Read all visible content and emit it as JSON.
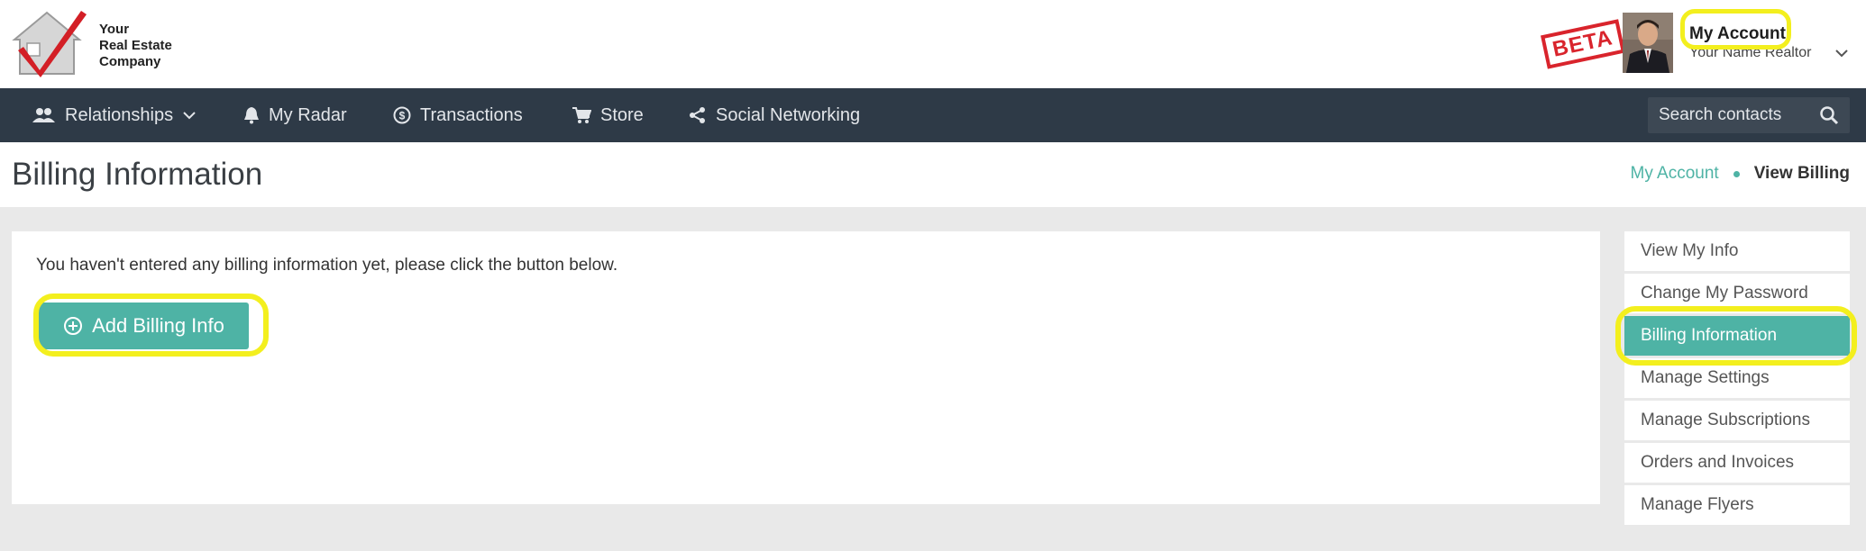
{
  "header": {
    "logo_lines": [
      "Your",
      "Real Estate",
      "Company"
    ],
    "beta_badge": "BETA",
    "account": {
      "title": "My Account",
      "name": "Your Name Realtor"
    }
  },
  "navbar": {
    "items": [
      {
        "label": "Relationships",
        "icon": "users-icon",
        "has_dropdown": true
      },
      {
        "label": "My Radar",
        "icon": "bell-icon"
      },
      {
        "label": "Transactions",
        "icon": "dollar-circle-icon"
      },
      {
        "label": "Store",
        "icon": "cart-icon"
      },
      {
        "label": "Social Networking",
        "icon": "share-icon"
      }
    ],
    "search": {
      "placeholder": "Search contacts"
    }
  },
  "page": {
    "title": "Billing Information",
    "breadcrumb": {
      "parent": "My Account",
      "current": "View Billing"
    }
  },
  "main": {
    "message": "You haven't entered any billing information yet, please click the button below.",
    "add_button_label": "Add Billing Info"
  },
  "side_menu": {
    "items": [
      {
        "label": "View My Info",
        "active": false
      },
      {
        "label": "Change My Password",
        "active": false
      },
      {
        "label": "Billing Information",
        "active": true
      },
      {
        "label": "Manage Settings",
        "active": false
      },
      {
        "label": "Manage Subscriptions",
        "active": false
      },
      {
        "label": "Orders and Invoices",
        "active": false
      },
      {
        "label": "Manage Flyers",
        "active": false
      }
    ]
  },
  "colors": {
    "accent": "#4eb3a5",
    "navbar": "#2e3a47",
    "highlight": "#f3ef1e",
    "beta": "#d9242c"
  }
}
